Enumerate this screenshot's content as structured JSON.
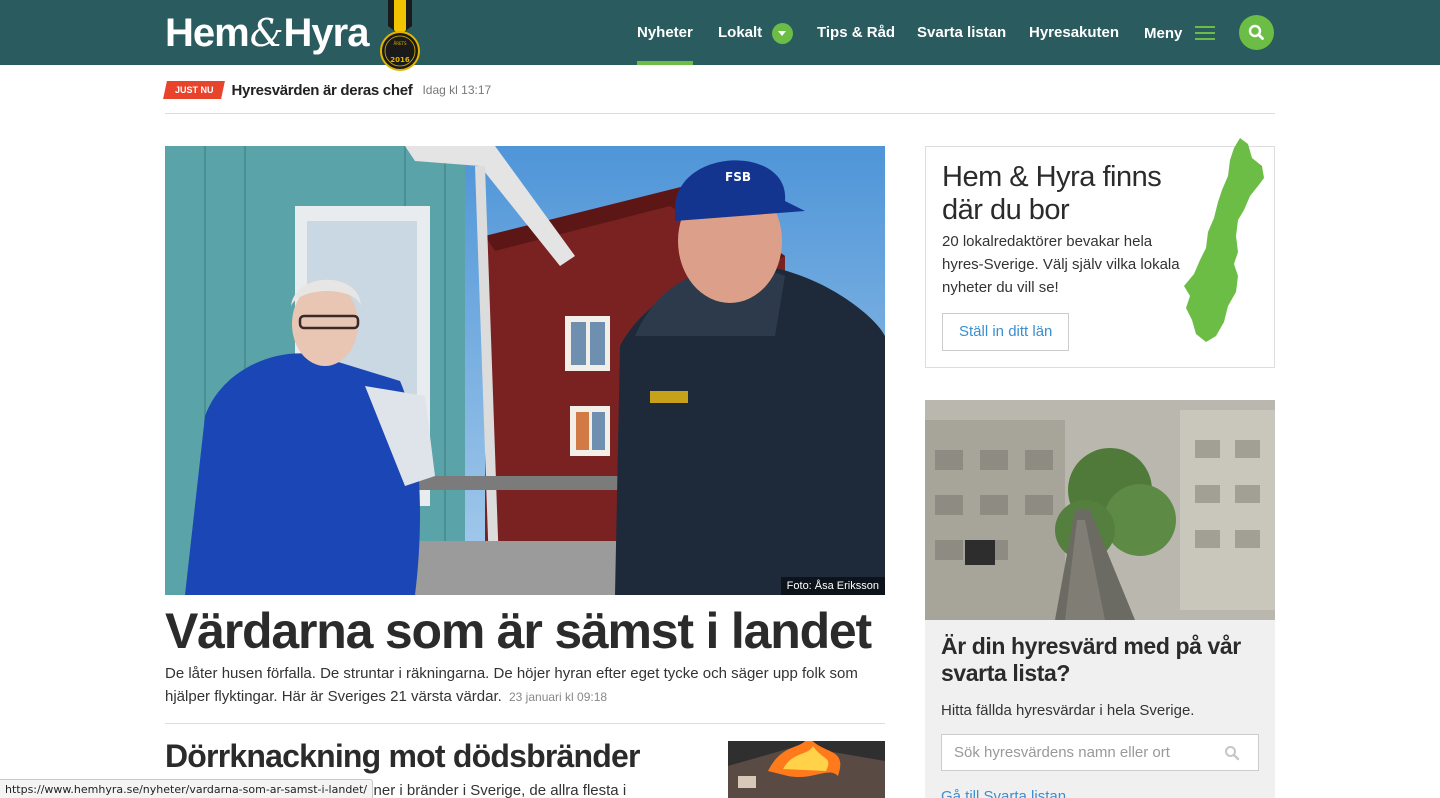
{
  "header": {
    "logo_left": "Hem",
    "logo_amp": "&",
    "logo_right": "Hyra",
    "medal_text": "2016",
    "nav": [
      {
        "label": "Nyheter",
        "active": true
      },
      {
        "label": "Lokalt"
      },
      {
        "label": "Tips & Råd"
      },
      {
        "label": "Svarta listan"
      },
      {
        "label": "Hyresakuten"
      },
      {
        "label": "Meny"
      }
    ],
    "search_icon": "search-icon",
    "menu_icon": "hamburger-icon"
  },
  "breaking": {
    "badge": "JUST NU",
    "title": "Hyresvärden är deras chef",
    "time": "Idag kl 13:17"
  },
  "main": {
    "photo_credit": "Foto: Åsa Eriksson",
    "headline": "Värdarna som är sämst i landet",
    "lead": "De låter husen förfalla. De struntar i räkningarna. De höjer hyran efter eget tycke och säger upp folk som hjälper flyktingar. Här är Sveriges 21 värsta värdar.",
    "date": "23 januari kl 09:18",
    "second_headline": "Dörrknackning mot dödsbränder",
    "second_lead": "personer i bränder i Sverige, de allra flesta i"
  },
  "sidebar": {
    "local": {
      "title": "Hem & Hyra finns där du bor",
      "text": "20 lokalredaktörer bevakar hela hyres-Sverige. Välj själv vilka lokala nyheter du vill se!",
      "button": "Ställ in ditt län"
    },
    "blacklist": {
      "title": "Är din hyresvärd med på vår svarta lista?",
      "text": "Hitta fällda hyresvärdar i hela Sverige.",
      "placeholder": "Sök hyresvärdens namn eller ort",
      "link": "Gå till Svarta listan"
    }
  },
  "status_url": "https://www.hemhyra.se/nyheter/vardarna-som-ar-samst-i-landet/",
  "colors": {
    "header_bg": "#2a5b5f",
    "accent_green": "#6cbd45",
    "badge_red": "#e8432b",
    "link_blue": "#3a8fcf"
  }
}
